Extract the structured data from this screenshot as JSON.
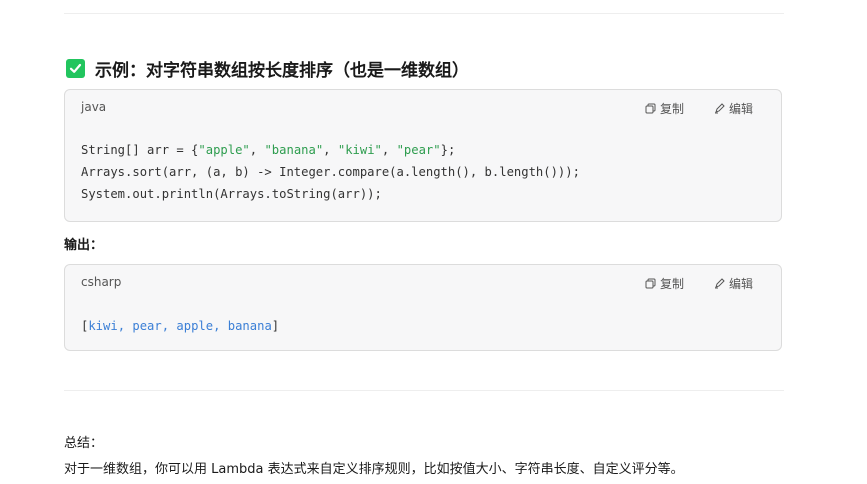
{
  "section": {
    "heading": "示例：对字符串数组按长度排序（也是一维数组）"
  },
  "code_block_1": {
    "language": "java",
    "copy_label": "复制",
    "edit_label": "编辑",
    "lines": [
      {
        "parts": [
          [
            "String[] arr = {",
            "plain"
          ],
          [
            "\"apple\"",
            "str"
          ],
          [
            ", ",
            "plain"
          ],
          [
            "\"banana\"",
            "str"
          ],
          [
            ", ",
            "plain"
          ],
          [
            "\"kiwi\"",
            "str"
          ],
          [
            ", ",
            "plain"
          ],
          [
            "\"pear\"",
            "str"
          ],
          [
            "};",
            "plain"
          ]
        ]
      },
      {
        "parts": [
          [
            "Arrays.sort(arr, (a, b) -> Integer.compare(a.length(), b.length()));",
            "plain"
          ]
        ]
      },
      {
        "parts": [
          [
            "System.out.println(Arrays.toString(arr));",
            "plain"
          ]
        ]
      }
    ]
  },
  "output_label": "输出：",
  "code_block_2": {
    "language": "csharp",
    "copy_label": "复制",
    "edit_label": "编辑",
    "lines": [
      {
        "parts": [
          [
            "[",
            "plain"
          ],
          [
            "kiwi, pear, apple, banana",
            "out"
          ],
          [
            "]",
            "plain"
          ]
        ]
      }
    ]
  },
  "summary": {
    "title": "总结：",
    "text": "对于一维数组，你可以用 Lambda 表达式来自定义排序规则，比如按值大小、字符串长度、自定义评分等。"
  },
  "colors": {
    "check": "#22c55e",
    "string": "#2e9d4f",
    "output": "#3b7fd6"
  }
}
